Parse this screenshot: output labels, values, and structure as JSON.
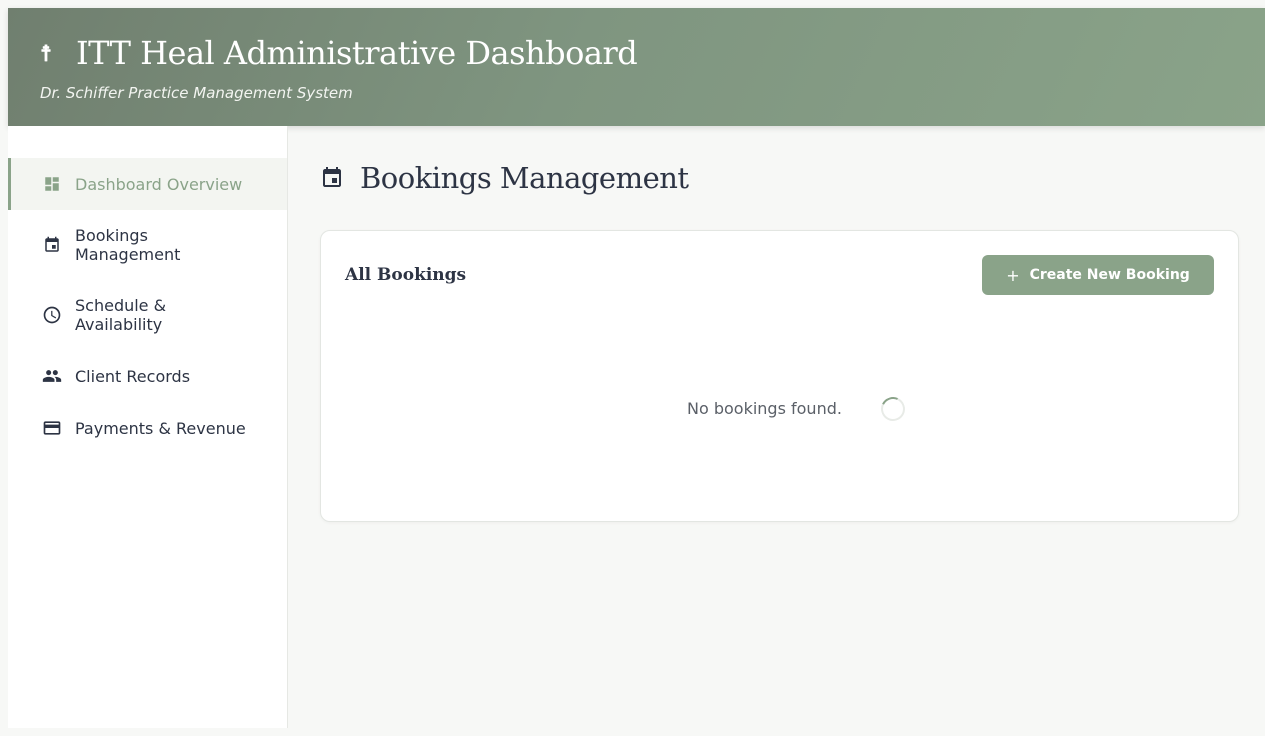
{
  "header": {
    "logo_glyph": "☨",
    "title": "ITT Heal Administrative Dashboard",
    "subtitle": "Dr. Schiffer Practice Management System"
  },
  "sidebar": {
    "items": [
      {
        "label": "Dashboard Overview",
        "icon": "dashboard-icon",
        "active": true
      },
      {
        "label": "Bookings Management",
        "icon": "calendar-icon",
        "active": false
      },
      {
        "label": "Schedule & Availability",
        "icon": "clock-icon",
        "active": false
      },
      {
        "label": "Client Records",
        "icon": "people-icon",
        "active": false
      },
      {
        "label": "Payments & Revenue",
        "icon": "credit-card-icon",
        "active": false
      }
    ]
  },
  "main": {
    "page_icon": "calendar-icon",
    "page_title": "Bookings Management",
    "card": {
      "title": "All Bookings",
      "create_button_icon": "+",
      "create_button_label": "Create New Booking",
      "empty_message": "No bookings found."
    }
  },
  "colors": {
    "accent": "#8aa389",
    "text": "#2d3444",
    "header_gradient_start": "#707f6f",
    "header_gradient_end": "#8aa389",
    "background": "#f7f8f6"
  }
}
